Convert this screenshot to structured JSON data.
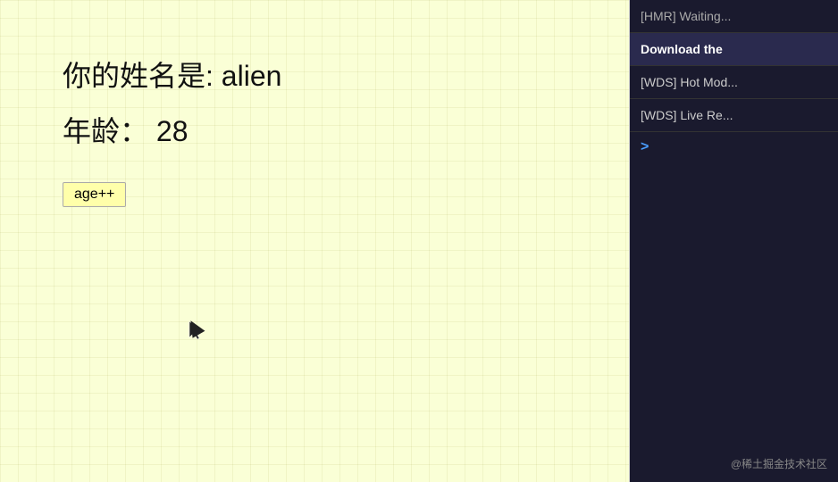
{
  "main": {
    "name_label": "你的姓名是:",
    "name_value": "alien",
    "age_label": "年龄：",
    "age_value": "28",
    "age_button_label": "age++"
  },
  "sidebar": {
    "items": [
      {
        "id": "hmr-waiting",
        "text": "[HMR] Waiting...",
        "bold": false
      },
      {
        "id": "download-the",
        "text": "Download the",
        "bold": true
      },
      {
        "id": "wds-hot-mod",
        "text": "[WDS] Hot Mod...",
        "bold": false
      },
      {
        "id": "wds-live-re",
        "text": "[WDS] Live Re...",
        "bold": false
      }
    ],
    "arrow": ">",
    "footer": "@稀土掘金技术社区"
  }
}
